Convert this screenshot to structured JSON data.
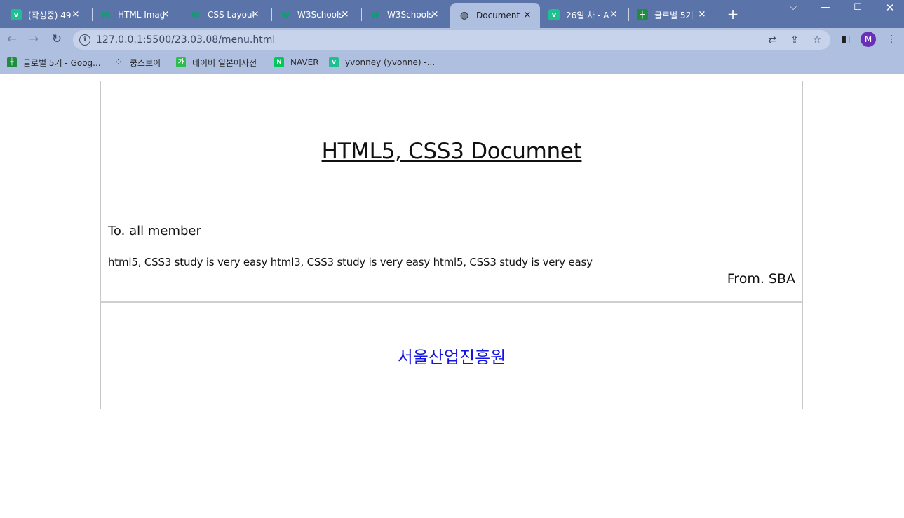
{
  "browser": {
    "tabs": [
      {
        "title": "(작성중) 49",
        "favicon": "v-icon"
      },
      {
        "title": "HTML Imag",
        "favicon": "w3schools-icon"
      },
      {
        "title": "CSS Layout",
        "favicon": "w3schools-icon"
      },
      {
        "title": "W3Schools",
        "favicon": "w3schools-icon"
      },
      {
        "title": "W3Schools",
        "favicon": "w3schools-icon"
      },
      {
        "title": "Document",
        "favicon": "globe-icon",
        "active": true
      },
      {
        "title": "26일 차 - A",
        "favicon": "v-icon"
      },
      {
        "title": "글로벌 5기",
        "favicon": "sheets-icon"
      }
    ],
    "url": "127.0.0.1:5500/23.03.08/menu.html",
    "profile_initial": "M",
    "bookmarks": [
      {
        "label": "글로벌 5기 - Goog...",
        "icon": "sheets-icon"
      },
      {
        "label": "쿵스보이",
        "icon": "dots-icon"
      },
      {
        "label": "네이버 일본어사전",
        "icon": "kakao-icon"
      },
      {
        "label": "NAVER",
        "icon": "naver-icon"
      },
      {
        "label": "yvonney (yvonne) -...",
        "icon": "v-icon"
      }
    ]
  },
  "page": {
    "title": "HTML5, CSS3 Documnet",
    "greeting": "To. all member",
    "body": "html5, CSS3 study is very easy html3, CSS3 study is very easy html5, CSS3 study is very easy",
    "signature": "From. SBA",
    "footer": "서울산업진흥원"
  },
  "colors": {
    "tabstrip": "#5a73a8",
    "toolbar": "#aebfe0",
    "footer_text": "#1515e0"
  }
}
